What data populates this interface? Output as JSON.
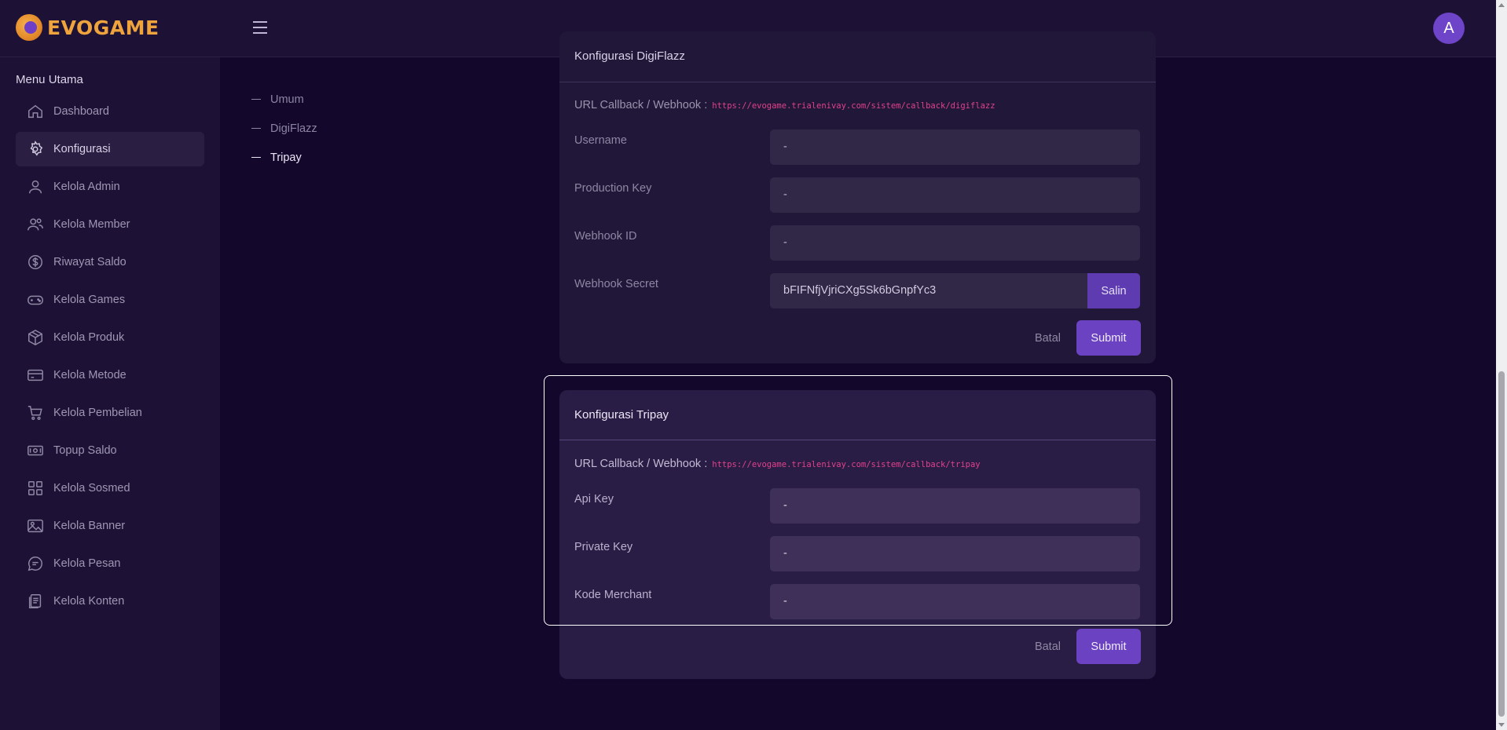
{
  "app": {
    "name": "EVOGAME",
    "avatar_initial": "A"
  },
  "sidebar": {
    "title": "Menu Utama",
    "items": [
      {
        "label": "Dashboard",
        "icon": "home-icon"
      },
      {
        "label": "Konfigurasi",
        "icon": "gear-icon",
        "active": true
      },
      {
        "label": "Kelola Admin",
        "icon": "user-icon"
      },
      {
        "label": "Kelola Member",
        "icon": "users-icon"
      },
      {
        "label": "Riwayat Saldo",
        "icon": "dollar-circle-icon"
      },
      {
        "label": "Kelola Games",
        "icon": "gamepad-icon"
      },
      {
        "label": "Kelola Produk",
        "icon": "box-icon"
      },
      {
        "label": "Kelola Metode",
        "icon": "card-icon"
      },
      {
        "label": "Kelola Pembelian",
        "icon": "cart-icon"
      },
      {
        "label": "Topup Saldo",
        "icon": "cash-icon"
      },
      {
        "label": "Kelola Sosmed",
        "icon": "grid-icon"
      },
      {
        "label": "Kelola Banner",
        "icon": "image-icon"
      },
      {
        "label": "Kelola Pesan",
        "icon": "chat-icon"
      },
      {
        "label": "Kelola Konten",
        "icon": "document-icon"
      }
    ]
  },
  "subnav": [
    {
      "label": "Umum"
    },
    {
      "label": "DigiFlazz"
    },
    {
      "label": "Tripay",
      "active": true
    }
  ],
  "digiflazz": {
    "title": "Konfigurasi DigiFlazz",
    "url_label": "URL Callback / Webhook :",
    "url": "https://evogame.trialenivay.com/sistem/callback/digiflazz",
    "fields": [
      {
        "label": "Username",
        "value": "-"
      },
      {
        "label": "Production Key",
        "value": "-"
      },
      {
        "label": "Webhook ID",
        "value": "-"
      }
    ],
    "secret_label": "Webhook Secret",
    "secret_value": "bFIFNfjVjriCXg5Sk6bGnpfYc3",
    "copy_label": "Salin",
    "cancel_label": "Batal",
    "submit_label": "Submit"
  },
  "tripay": {
    "title": "Konfigurasi Tripay",
    "url_label": "URL Callback / Webhook :",
    "url": "https://evogame.trialenivay.com/sistem/callback/tripay",
    "fields": [
      {
        "label": "Api Key",
        "value": "-"
      },
      {
        "label": "Private Key",
        "value": "-"
      },
      {
        "label": "Kode Merchant",
        "value": "-"
      }
    ],
    "cancel_label": "Batal",
    "submit_label": "Submit"
  },
  "colors": {
    "accent": "#6a42c2",
    "url": "#e0428b",
    "logo": "#efa33c"
  }
}
